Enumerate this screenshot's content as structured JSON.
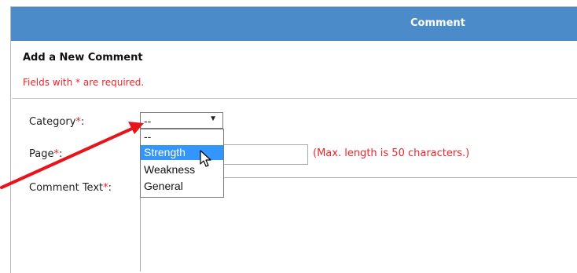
{
  "header": {
    "title": "Comment"
  },
  "form": {
    "section_title": "Add a New Comment",
    "required_note": "Fields with * are required.",
    "category_label": "Category",
    "page_label": "Page",
    "comment_text_label": "Comment Text",
    "required_mark": "*",
    "label_suffix": ":",
    "category_selected": "--",
    "page_hint": "(Max. length is 50 characters.)",
    "page_value": "",
    "comment_value": ""
  },
  "dropdown": {
    "options": [
      "--",
      "Strength",
      "Weakness",
      "General"
    ],
    "highlighted": "Strength"
  },
  "colors": {
    "header_bg": "#4b8bc9",
    "required_red": "#e8262c",
    "highlight_blue": "#3296fe",
    "annotation_arrow": "#e8141c"
  }
}
